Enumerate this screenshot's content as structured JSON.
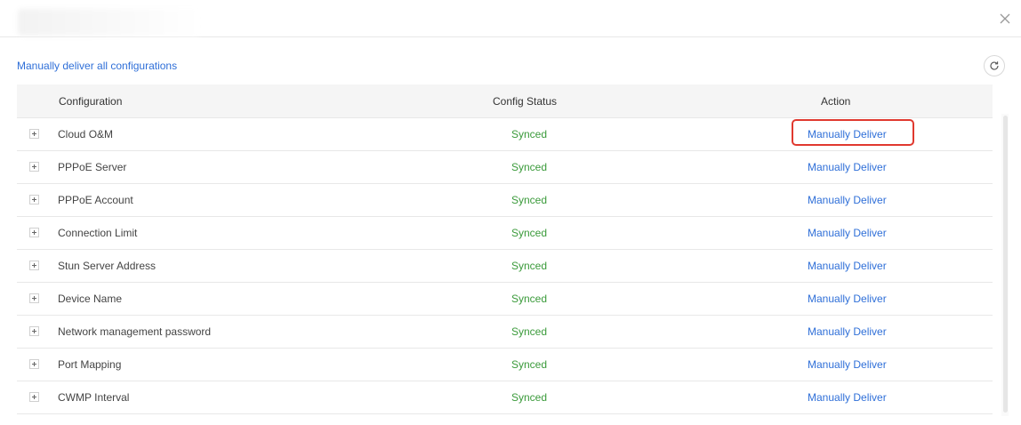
{
  "dialog": {
    "close_icon": "close-icon"
  },
  "toolbar": {
    "deliver_all_label": "Manually deliver all configurations",
    "refresh_icon": "refresh-icon"
  },
  "table": {
    "columns": [
      "Configuration",
      "Config Status",
      "Action"
    ],
    "rows": [
      {
        "name": "Cloud O&M",
        "status": "Synced",
        "action": "Manually Deliver"
      },
      {
        "name": "PPPoE Server",
        "status": "Synced",
        "action": "Manually Deliver"
      },
      {
        "name": "PPPoE Account",
        "status": "Synced",
        "action": "Manually Deliver"
      },
      {
        "name": "Connection Limit",
        "status": "Synced",
        "action": "Manually Deliver"
      },
      {
        "name": "Stun Server Address",
        "status": "Synced",
        "action": "Manually Deliver"
      },
      {
        "name": "Device Name",
        "status": "Synced",
        "action": "Manually Deliver"
      },
      {
        "name": "Network management password",
        "status": "Synced",
        "action": "Manually Deliver"
      },
      {
        "name": "Port Mapping",
        "status": "Synced",
        "action": "Manually Deliver"
      },
      {
        "name": "CWMP Interval",
        "status": "Synced",
        "action": "Manually Deliver"
      }
    ]
  },
  "colors": {
    "link": "#2f6fd8",
    "synced": "#3a9a3a",
    "highlight": "#e0392f"
  }
}
